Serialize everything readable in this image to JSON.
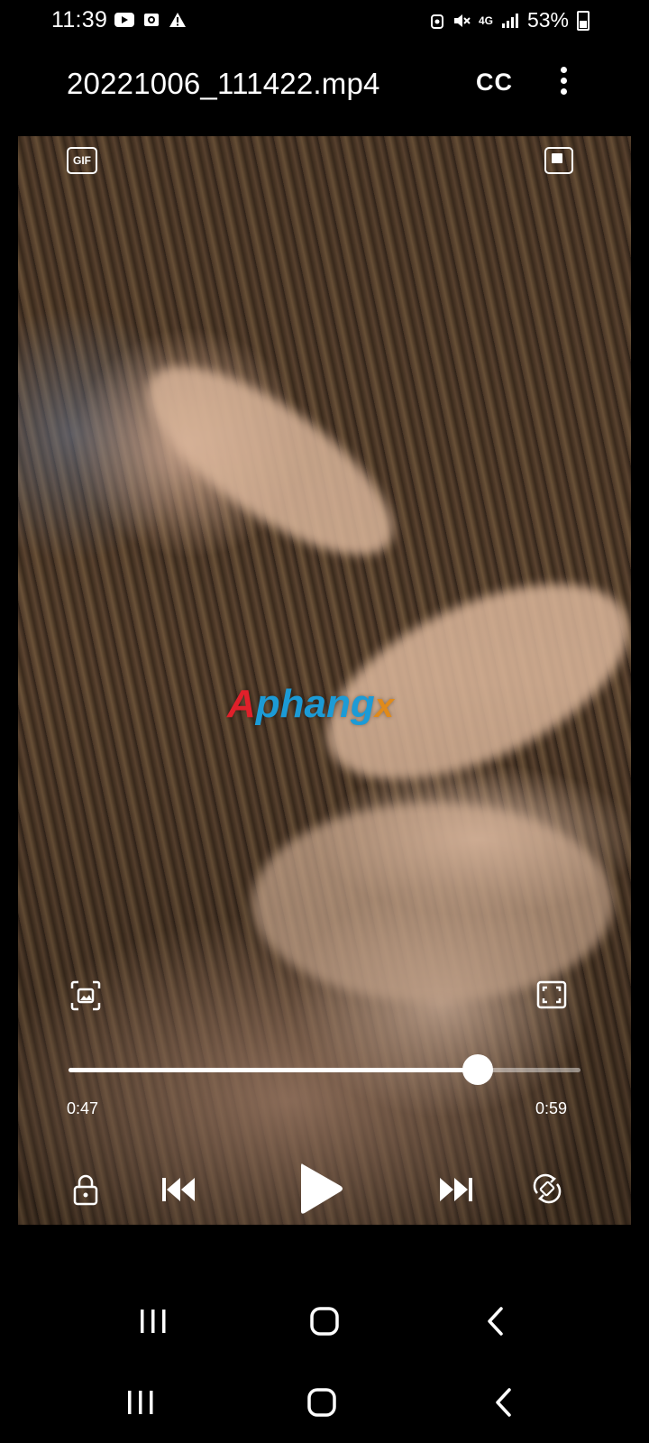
{
  "status_bar": {
    "time": "11:39",
    "left_icons": [
      "youtube-icon",
      "camera-notification-icon",
      "warning-icon"
    ],
    "right_icons": [
      "alarm-icon",
      "mute-icon",
      "4g-icon",
      "signal-icon"
    ],
    "network_label": "4G",
    "battery_text": "53%"
  },
  "header": {
    "title": "20221006_111422.mp4",
    "cc_label": "CC",
    "more_icon": "more-vertical-icon"
  },
  "video": {
    "top_left_icon": "gif-icon",
    "top_left_label": "GIF",
    "top_right_icon": "popup-play-icon",
    "watermark": {
      "part1": "A",
      "part2": "phang",
      "part3": "x"
    },
    "bottom_left_icon": "capture-icon",
    "bottom_right_icon": "fit-screen-icon"
  },
  "playback": {
    "current_time": "0:47",
    "total_time": "0:59",
    "progress_fraction": 0.8
  },
  "controls": {
    "lock_icon": "lock-icon",
    "previous_icon": "skip-previous-icon",
    "play_icon": "play-icon",
    "next_icon": "skip-next-icon",
    "rotate_icon": "screen-rotate-icon"
  },
  "navigation": {
    "recents_icon": "recents-icon",
    "home_icon": "home-icon",
    "back_icon": "back-icon"
  },
  "colors": {
    "background": "#000000",
    "progress": "#ffffff",
    "watermark_red": "#e0202a",
    "watermark_blue": "#2255c8",
    "watermark_orange": "#e08a1a"
  }
}
